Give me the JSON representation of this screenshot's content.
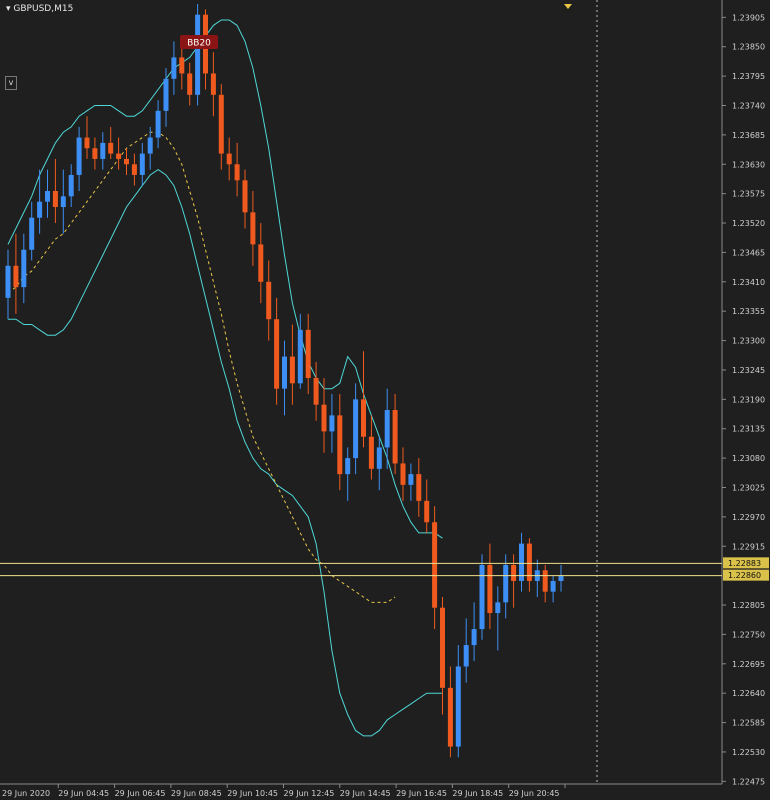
{
  "chart_title": "GBPUSD,M15",
  "indicator_badge": "BB20",
  "v_button": "v",
  "colors": {
    "background": "#1f1f1f",
    "bull": "#3d8ff5",
    "bear": "#f05a1e",
    "bands": "#4fd7d7",
    "midline": "#e8c547",
    "hline": "#f0e08a",
    "axis_text": "#cfcfcf"
  },
  "chart_data": {
    "type": "candlestick",
    "title": "GBPUSD,M15",
    "ylim": [
      1.2247,
      1.2393
    ],
    "y_ticks": [
      "1.23905",
      "1.23850",
      "1.23795",
      "1.23740",
      "1.23685",
      "1.23630",
      "1.23575",
      "1.23520",
      "1.23465",
      "1.23410",
      "1.23355",
      "1.23300",
      "1.23245",
      "1.23190",
      "1.23135",
      "1.23080",
      "1.23025",
      "1.22970",
      "1.22915",
      "1.22805",
      "1.22750",
      "1.22695",
      "1.22640",
      "1.22585",
      "1.22530",
      "1.22475"
    ],
    "x_ticks": [
      "29 Jun 2020",
      "29 Jun 04:45",
      "29 Jun 06:45",
      "29 Jun 08:45",
      "29 Jun 10:45",
      "29 Jun 12:45",
      "29 Jun 14:45",
      "29 Jun 16:45",
      "29 Jun 18:45",
      "29 Jun 20:45"
    ],
    "price_labels": [
      "1.22883",
      "1.22860"
    ],
    "horizontal_lines": [
      1.22883,
      1.2286
    ],
    "ohlc": [
      [
        1.2338,
        1.2347,
        1.2334,
        1.2344
      ],
      [
        1.2344,
        1.235,
        1.2335,
        1.234
      ],
      [
        1.234,
        1.235,
        1.2337,
        1.2347
      ],
      [
        1.2347,
        1.2356,
        1.2345,
        1.2353
      ],
      [
        1.2353,
        1.2362,
        1.235,
        1.2356
      ],
      [
        1.2356,
        1.2362,
        1.2353,
        1.2358
      ],
      [
        1.2358,
        1.2364,
        1.2352,
        1.2355
      ],
      [
        1.2355,
        1.2362,
        1.235,
        1.2357
      ],
      [
        1.2357,
        1.2363,
        1.2355,
        1.2361
      ],
      [
        1.2361,
        1.237,
        1.2358,
        1.2368
      ],
      [
        1.2368,
        1.2372,
        1.2364,
        1.2366
      ],
      [
        1.2366,
        1.2368,
        1.2362,
        1.2364
      ],
      [
        1.2364,
        1.2369,
        1.2362,
        1.2367
      ],
      [
        1.2367,
        1.237,
        1.2364,
        1.2365
      ],
      [
        1.2365,
        1.2368,
        1.2362,
        1.2364
      ],
      [
        1.2364,
        1.2366,
        1.2361,
        1.2363
      ],
      [
        1.2363,
        1.2365,
        1.2359,
        1.2361
      ],
      [
        1.2361,
        1.2367,
        1.2359,
        1.2365
      ],
      [
        1.2365,
        1.237,
        1.2362,
        1.2368
      ],
      [
        1.2368,
        1.2375,
        1.2366,
        1.2373
      ],
      [
        1.2373,
        1.2381,
        1.237,
        1.2379
      ],
      [
        1.2379,
        1.2386,
        1.2376,
        1.2383
      ],
      [
        1.2383,
        1.2387,
        1.2377,
        1.238
      ],
      [
        1.238,
        1.2382,
        1.2374,
        1.2376
      ],
      [
        1.2376,
        1.2393,
        1.2374,
        1.2391
      ],
      [
        1.2391,
        1.2392,
        1.2377,
        1.238
      ],
      [
        1.238,
        1.2384,
        1.2372,
        1.2376
      ],
      [
        1.2376,
        1.2378,
        1.2362,
        1.2365
      ],
      [
        1.2365,
        1.2368,
        1.236,
        1.2363
      ],
      [
        1.2363,
        1.2367,
        1.2357,
        1.236
      ],
      [
        1.236,
        1.2362,
        1.2351,
        1.2354
      ],
      [
        1.2354,
        1.2358,
        1.2344,
        1.2348
      ],
      [
        1.2348,
        1.2352,
        1.2337,
        1.2341
      ],
      [
        1.2341,
        1.2345,
        1.233,
        1.2334
      ],
      [
        1.2334,
        1.2338,
        1.2318,
        1.2321
      ],
      [
        1.2321,
        1.233,
        1.2316,
        1.2327
      ],
      [
        1.2327,
        1.2333,
        1.2318,
        1.2322
      ],
      [
        1.2322,
        1.2335,
        1.2321,
        1.2332
      ],
      [
        1.2332,
        1.2335,
        1.232,
        1.2323
      ],
      [
        1.2323,
        1.2326,
        1.2315,
        1.2318
      ],
      [
        1.2318,
        1.2323,
        1.2309,
        1.2313
      ],
      [
        1.2313,
        1.232,
        1.2309,
        1.2316
      ],
      [
        1.2316,
        1.232,
        1.2302,
        1.2305
      ],
      [
        1.2305,
        1.231,
        1.23,
        1.2308
      ],
      [
        1.2308,
        1.2322,
        1.2305,
        1.2319
      ],
      [
        1.2319,
        1.2328,
        1.231,
        1.2312
      ],
      [
        1.2312,
        1.2316,
        1.2304,
        1.2306
      ],
      [
        1.2306,
        1.2312,
        1.2302,
        1.231
      ],
      [
        1.231,
        1.2321,
        1.2306,
        1.2317
      ],
      [
        1.2317,
        1.232,
        1.2305,
        1.2307
      ],
      [
        1.2307,
        1.231,
        1.23,
        1.2303
      ],
      [
        1.2303,
        1.2307,
        1.23,
        1.2305
      ],
      [
        1.2305,
        1.2308,
        1.2297,
        1.23
      ],
      [
        1.23,
        1.2304,
        1.2294,
        1.2296
      ],
      [
        1.2296,
        1.2299,
        1.2276,
        1.228
      ],
      [
        1.228,
        1.2282,
        1.226,
        1.2265
      ],
      [
        1.2265,
        1.2269,
        1.2252,
        1.2254
      ],
      [
        1.2254,
        1.2273,
        1.2252,
        1.2269
      ],
      [
        1.2269,
        1.2278,
        1.2266,
        1.2273
      ],
      [
        1.2273,
        1.2281,
        1.227,
        1.2276
      ],
      [
        1.2276,
        1.229,
        1.2274,
        1.2288
      ],
      [
        1.2288,
        1.2292,
        1.2276,
        1.2279
      ],
      [
        1.2279,
        1.2284,
        1.2272,
        1.2281
      ],
      [
        1.2281,
        1.229,
        1.2278,
        1.2288
      ],
      [
        1.2288,
        1.229,
        1.228,
        1.2285
      ],
      [
        1.2285,
        1.2294,
        1.2283,
        1.2292
      ],
      [
        1.2292,
        1.2293,
        1.2283,
        1.2285
      ],
      [
        1.2285,
        1.2289,
        1.2282,
        1.2287
      ],
      [
        1.2287,
        1.2288,
        1.2281,
        1.2283
      ],
      [
        1.2283,
        1.2286,
        1.2281,
        1.2285
      ],
      [
        1.2285,
        1.2288,
        1.2283,
        1.2286
      ]
    ],
    "upper_band": [
      1.2348,
      1.2351,
      1.2354,
      1.2357,
      1.2361,
      1.2364,
      1.2367,
      1.2369,
      1.237,
      1.2372,
      1.2373,
      1.2374,
      1.2374,
      1.2374,
      1.2373,
      1.2372,
      1.2372,
      1.2373,
      1.2375,
      1.2377,
      1.2379,
      1.2381,
      1.2382,
      1.2383,
      1.2385,
      1.2387,
      1.2389,
      1.239,
      1.239,
      1.2389,
      1.2386,
      1.2381,
      1.2374,
      1.2366,
      1.2356,
      1.2346,
      1.2337,
      1.2331,
      1.2326,
      1.2323,
      1.2321,
      1.2321,
      1.2322,
      1.2327,
      1.2325,
      1.232,
      1.2316,
      1.2312,
      1.2308,
      1.2303,
      1.2299,
      1.2296,
      1.2294,
      1.2294,
      1.2294,
      1.2293
    ],
    "lower_band": [
      1.2334,
      1.2334,
      1.2333,
      1.2333,
      1.2332,
      1.2331,
      1.2331,
      1.2332,
      1.2334,
      1.2337,
      1.234,
      1.2343,
      1.2346,
      1.2349,
      1.2352,
      1.2355,
      1.2357,
      1.2359,
      1.2361,
      1.2362,
      1.2361,
      1.2359,
      1.2355,
      1.235,
      1.2344,
      1.2338,
      1.2332,
      1.2326,
      1.2321,
      1.2315,
      1.2311,
      1.2308,
      1.2306,
      1.2305,
      1.2303,
      1.2302,
      1.2301,
      1.2299,
      1.2297,
      1.2292,
      1.2283,
      1.2272,
      1.2264,
      1.226,
      1.2257,
      1.2256,
      1.2256,
      1.2257,
      1.2259,
      1.226,
      1.2261,
      1.2262,
      1.2263,
      1.2264,
      1.2264,
      1.2264
    ],
    "middle_band": [
      1.2339,
      1.234,
      1.2342,
      1.2343,
      1.2345,
      1.2347,
      1.2349,
      1.235,
      1.2352,
      1.2354,
      1.2356,
      1.2358,
      1.236,
      1.2362,
      1.2364,
      1.2366,
      1.2367,
      1.2368,
      1.2369,
      1.2369,
      1.2368,
      1.2366,
      1.2363,
      1.2358,
      1.2353,
      1.2347,
      1.2341,
      1.2335,
      1.2328,
      1.2322,
      1.2317,
      1.2312,
      1.2309,
      1.2306,
      1.2303,
      1.23,
      1.2297,
      1.2294,
      1.2291,
      1.2289,
      1.2288,
      1.2286,
      1.2285,
      1.2284,
      1.2283,
      1.2282,
      1.2281,
      1.2281,
      1.2281,
      1.2282
    ]
  }
}
